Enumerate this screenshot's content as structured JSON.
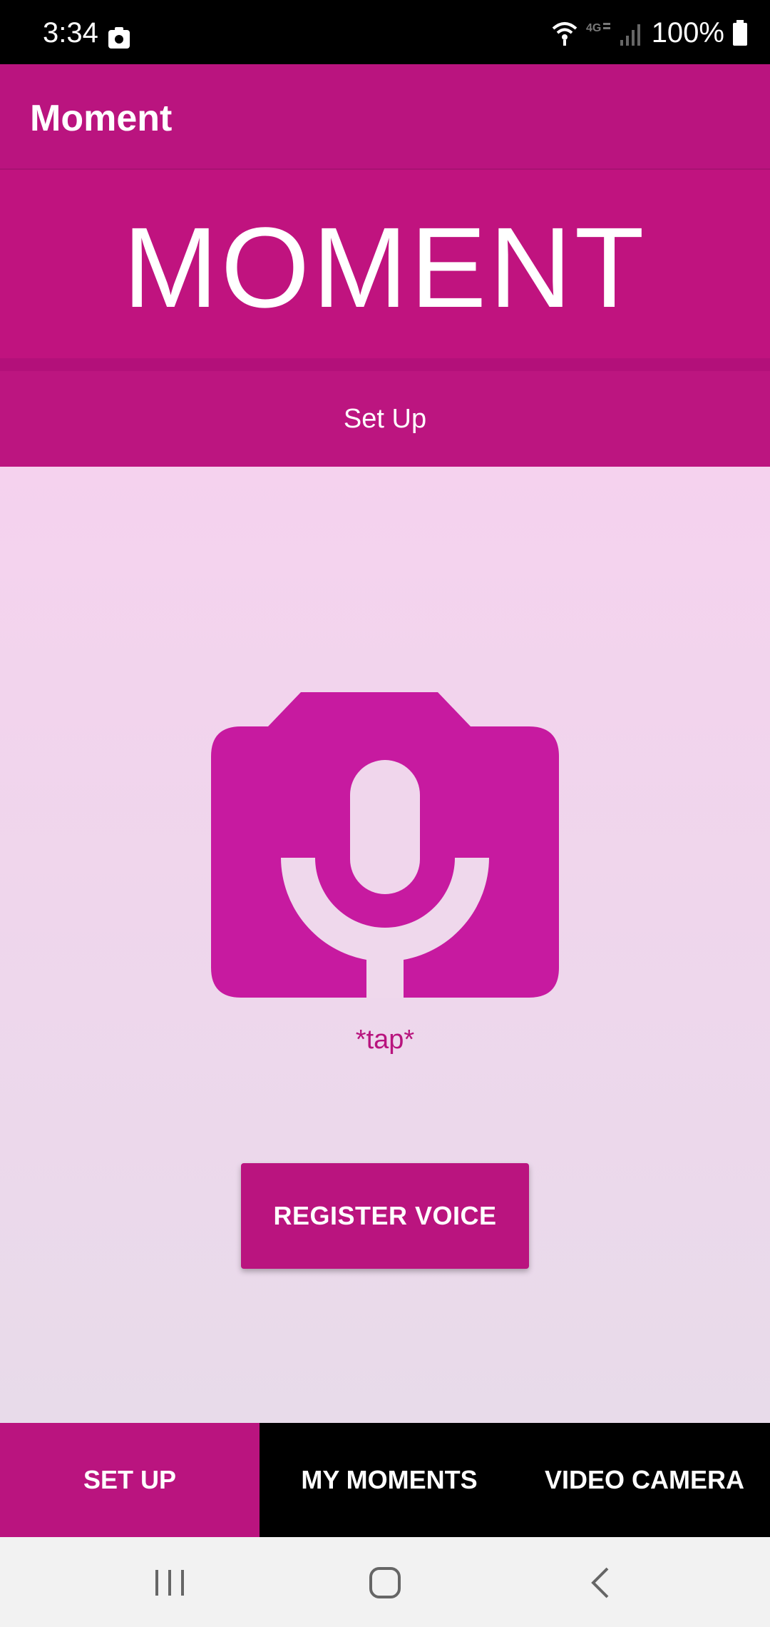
{
  "status_bar": {
    "time": "3:34",
    "battery": "100%",
    "icons": [
      "photo-icon",
      "wifi-icon",
      "lte-icon",
      "signal-icon",
      "battery-icon"
    ]
  },
  "app_bar": {
    "title": "Moment"
  },
  "banner": {
    "title": "MOMENT"
  },
  "section": {
    "title": "Set Up"
  },
  "main": {
    "icon": "voice-camera-icon",
    "tap_label": "*tap*",
    "register_button": "REGISTER VOICE"
  },
  "tabs": [
    {
      "label": "SET UP",
      "active": true
    },
    {
      "label": "MY MOMENTS",
      "active": false
    },
    {
      "label": "VIDEO CAMERA",
      "active": false
    }
  ],
  "nav": {
    "icons": [
      "recents-icon",
      "home-icon",
      "back-icon"
    ]
  },
  "colors": {
    "primary": "#BA147F",
    "icon": "#C71AA0",
    "background_top": "#F5D2EE",
    "background_bottom": "#E8DBEA"
  }
}
